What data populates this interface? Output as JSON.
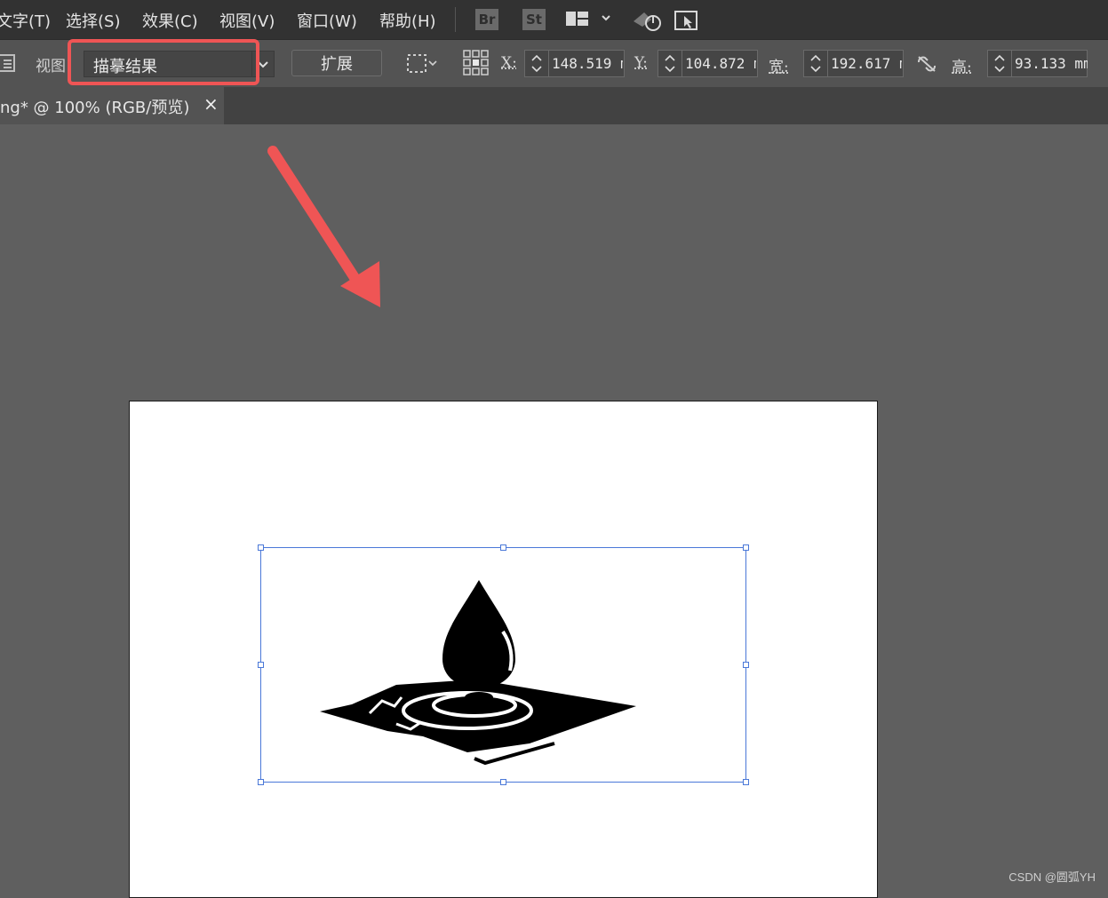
{
  "menu": {
    "items": [
      "文字(T)",
      "选择(S)",
      "效果(C)",
      "视图(V)",
      "窗口(W)",
      "帮助(H)"
    ],
    "app_icons": [
      "Br",
      "St"
    ]
  },
  "control_bar": {
    "view_label": "视图：",
    "view_value": "描摹结果",
    "expand_button": "扩展",
    "x_label": "X:",
    "x_value": "148.519 m",
    "y_label": "Y:",
    "y_value": "104.872 m",
    "w_label": "宽:",
    "w_value": "192.617 m",
    "h_label": "高:",
    "h_value": "93.133 mm"
  },
  "tab": {
    "title": "ng* @ 100% (RGB/预览)",
    "close": "×"
  },
  "watermark": "CSDN @圆弧YH",
  "colors": {
    "menu_bg": "#323232",
    "control_bg": "#535353",
    "canvas_bg": "#5f5f5f",
    "highlight": "#ef5555",
    "selection": "#4a78d8"
  },
  "icons": [
    "workspace-switcher-icon",
    "gpu-performance-icon",
    "touch-workspace-icon",
    "transform-reference-icon",
    "constrain-proportions-icon",
    "artboard-bounds-icon"
  ]
}
